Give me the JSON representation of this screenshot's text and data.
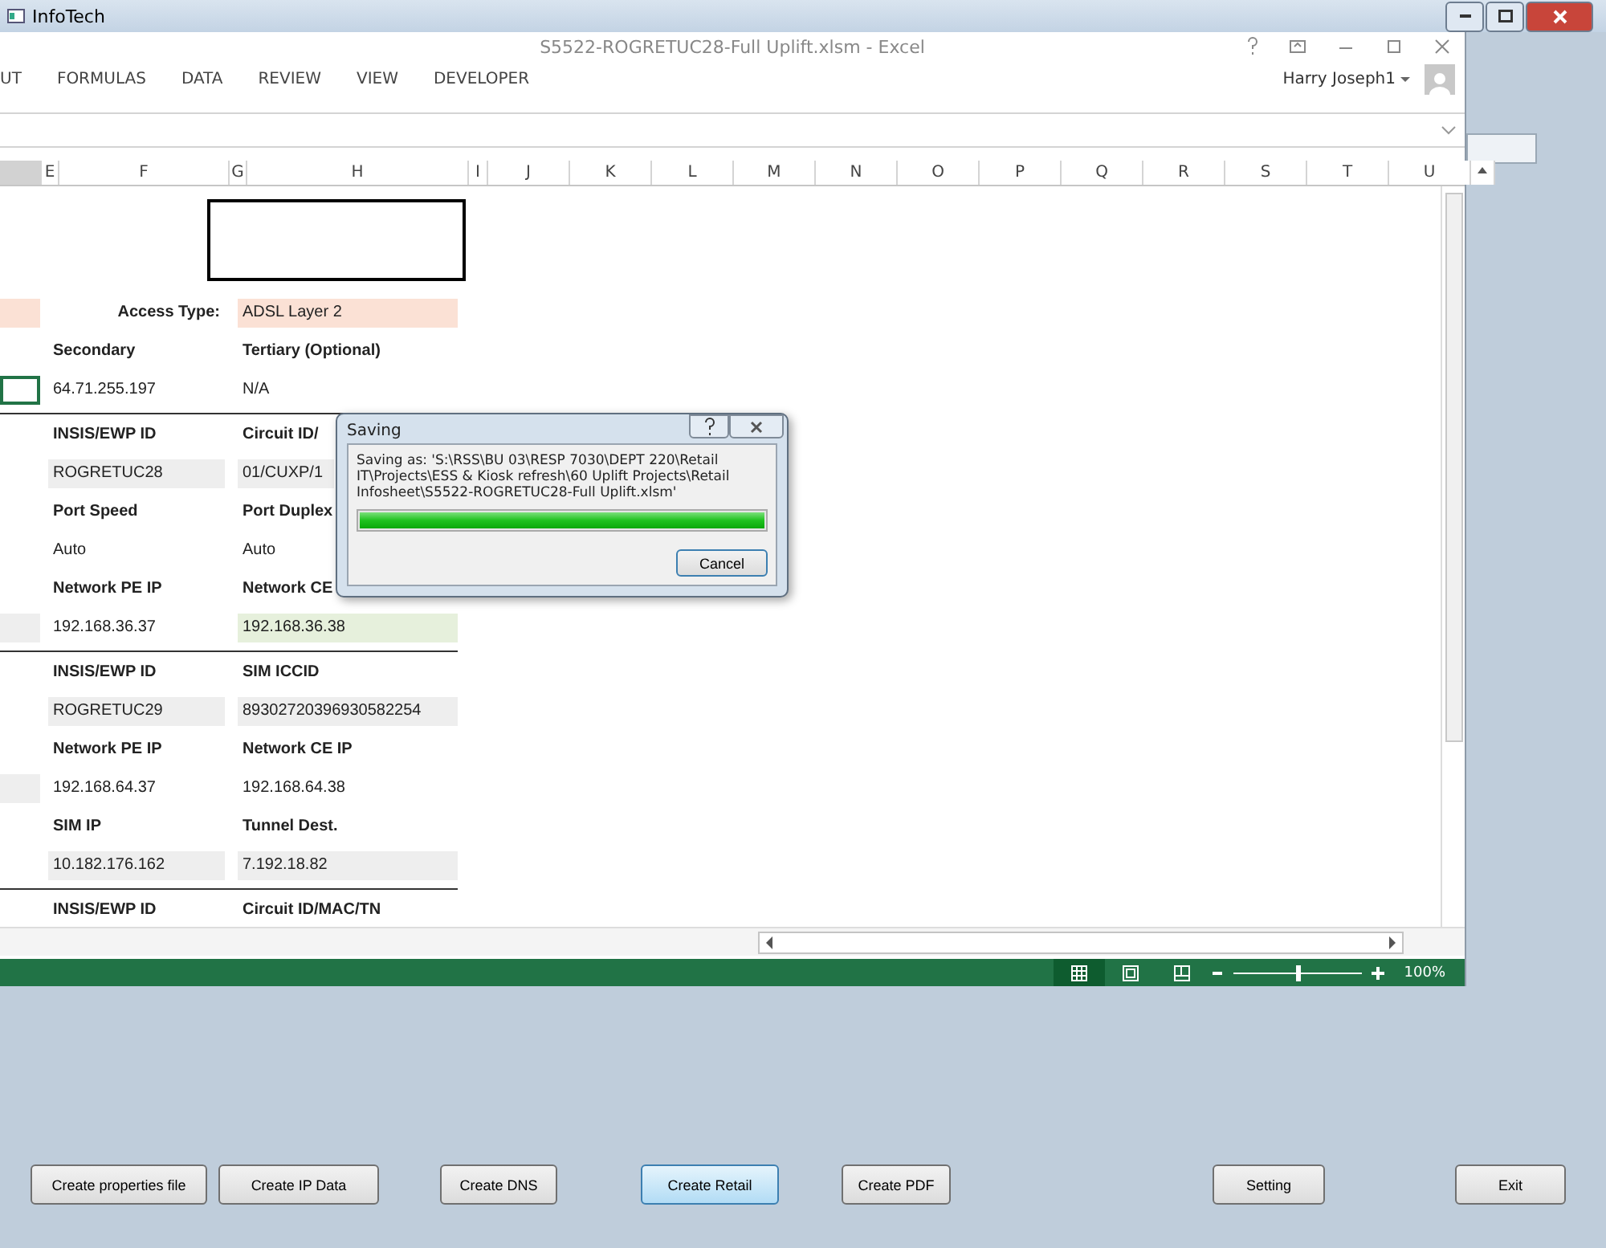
{
  "infotech_window": {
    "title": "InfoTech",
    "buttons": [
      {
        "label": "Create properties file",
        "selected": false
      },
      {
        "label": "Create IP Data",
        "selected": false
      },
      {
        "label": "Create DNS",
        "selected": false
      },
      {
        "label": "Create Retail",
        "selected": true
      },
      {
        "label": "Create PDF",
        "selected": false
      },
      {
        "label": "Setting",
        "selected": false
      },
      {
        "label": "Exit",
        "selected": false
      }
    ]
  },
  "excel": {
    "title": "S5522-ROGRETUC28-Full Uplift.xlsm - Excel",
    "ribbon_tabs": [
      "UT",
      "FORMULAS",
      "DATA",
      "REVIEW",
      "VIEW",
      "DEVELOPER"
    ],
    "user": "Harry Joseph1",
    "columns": [
      "E",
      "F",
      "G",
      "H",
      "I",
      "J",
      "K",
      "L",
      "M",
      "N",
      "O",
      "P",
      "Q",
      "R",
      "S",
      "T",
      "U"
    ],
    "rows": [
      {
        "kind": "box"
      },
      {
        "kind": "fields",
        "left": {
          "selected": false,
          "color": "#fbe1d5"
        },
        "f": {
          "text": "Access Type:",
          "kind": "label_right"
        },
        "h": {
          "text": "ADSL Layer 2",
          "kind": "value",
          "color": "#fbe1d5"
        }
      },
      {
        "kind": "fields",
        "f": {
          "text": "Secondary",
          "kind": "label"
        },
        "h": {
          "text": "Tertiary (Optional)",
          "kind": "label"
        }
      },
      {
        "kind": "fields",
        "left": {
          "selected": true
        },
        "f": {
          "text": "64.71.255.197",
          "kind": "value"
        },
        "h": {
          "text": "N/A",
          "kind": "value"
        }
      },
      {
        "kind": "divider"
      },
      {
        "kind": "fields",
        "f": {
          "text": "INSIS/EWP ID",
          "kind": "label"
        },
        "h": {
          "text": "Circuit ID/",
          "kind": "label"
        }
      },
      {
        "kind": "fields",
        "f": {
          "text": "ROGRETUC28",
          "kind": "value",
          "color": "#eeeeee"
        },
        "h": {
          "text": "01/CUXP/1",
          "kind": "value",
          "color": "#eeeeee"
        }
      },
      {
        "kind": "fields",
        "f": {
          "text": "Port Speed",
          "kind": "label"
        },
        "h": {
          "text": "Port Duplex",
          "kind": "label"
        }
      },
      {
        "kind": "fields",
        "f": {
          "text": "Auto",
          "kind": "value"
        },
        "h": {
          "text": "Auto",
          "kind": "value"
        }
      },
      {
        "kind": "fields",
        "f": {
          "text": "Network PE IP",
          "kind": "label"
        },
        "h": {
          "text": "Network CE",
          "kind": "label"
        }
      },
      {
        "kind": "fields",
        "left": {
          "selected": false,
          "color": "#eeeeee"
        },
        "f": {
          "text": "192.168.36.37",
          "kind": "value"
        },
        "h": {
          "text": "192.168.36.38",
          "kind": "value",
          "color": "#e6f0dc"
        }
      },
      {
        "kind": "divider"
      },
      {
        "kind": "fields",
        "f": {
          "text": "INSIS/EWP ID",
          "kind": "label"
        },
        "h": {
          "text": "SIM ICCID",
          "kind": "label"
        }
      },
      {
        "kind": "fields",
        "f": {
          "text": "ROGRETUC29",
          "kind": "value",
          "color": "#eeeeee"
        },
        "h": {
          "text": "89302720396930582254",
          "kind": "value",
          "color": "#eeeeee"
        }
      },
      {
        "kind": "fields",
        "f": {
          "text": "Network PE IP",
          "kind": "label"
        },
        "h": {
          "text": "Network CE IP",
          "kind": "label"
        }
      },
      {
        "kind": "fields",
        "left": {
          "selected": false,
          "color": "#eeeeee"
        },
        "f": {
          "text": "192.168.64.37",
          "kind": "value"
        },
        "h": {
          "text": "192.168.64.38",
          "kind": "value"
        }
      },
      {
        "kind": "fields",
        "f": {
          "text": "SIM IP",
          "kind": "label"
        },
        "h": {
          "text": "Tunnel Dest.",
          "kind": "label"
        }
      },
      {
        "kind": "fields",
        "f": {
          "text": "10.182.176.162",
          "kind": "value",
          "color": "#eeeeee"
        },
        "h": {
          "text": "7.192.18.82",
          "kind": "value",
          "color": "#eeeeee"
        }
      },
      {
        "kind": "divider"
      },
      {
        "kind": "fields",
        "f": {
          "text": "INSIS/EWP ID",
          "kind": "label"
        },
        "h": {
          "text": "Circuit ID/MAC/TN",
          "kind": "label"
        }
      }
    ],
    "status_bar": {
      "views": [
        {
          "kind": "normal",
          "selected": true
        },
        {
          "kind": "page_layout",
          "selected": false
        },
        {
          "kind": "page_break",
          "selected": false
        }
      ],
      "zoom": {
        "level": 0.5,
        "reading": "100%"
      }
    }
  },
  "dialog": {
    "title": "Saving",
    "message": "Saving as: 'S:\\RSS\\BU 03\\RESP 7030\\DEPT 220\\Retail IT\\Projects\\ESS & Kiosk refresh\\60 Uplift Projects\\Retail Infosheet\\S5522-ROGRETUC28-Full Uplift.xlsm'",
    "progress": {
      "level": 1
    },
    "button": "Cancel"
  }
}
